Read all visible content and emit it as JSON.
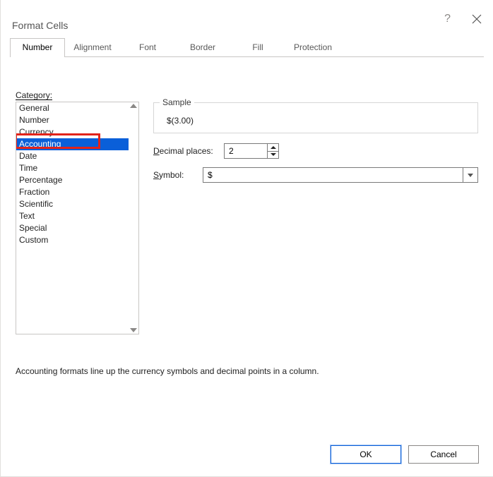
{
  "window": {
    "title": "Format Cells",
    "help_symbol": "?"
  },
  "tabs": [
    {
      "label": "Number",
      "active": true
    },
    {
      "label": "Alignment",
      "active": false
    },
    {
      "label": "Font",
      "active": false
    },
    {
      "label": "Border",
      "active": false
    },
    {
      "label": "Fill",
      "active": false
    },
    {
      "label": "Protection",
      "active": false
    }
  ],
  "category": {
    "label": "Category:",
    "items": [
      "General",
      "Number",
      "Currency",
      "Accounting",
      "Date",
      "Time",
      "Percentage",
      "Fraction",
      "Scientific",
      "Text",
      "Special",
      "Custom"
    ],
    "selected_index": 3
  },
  "sample": {
    "legend": "Sample",
    "value": "$(3.00)"
  },
  "decimal": {
    "label": "Decimal places:",
    "value": "2"
  },
  "symbol": {
    "label": "Symbol:",
    "value": "$"
  },
  "description": "Accounting formats line up the currency symbols and decimal points in a column.",
  "buttons": {
    "ok": "OK",
    "cancel": "Cancel"
  }
}
